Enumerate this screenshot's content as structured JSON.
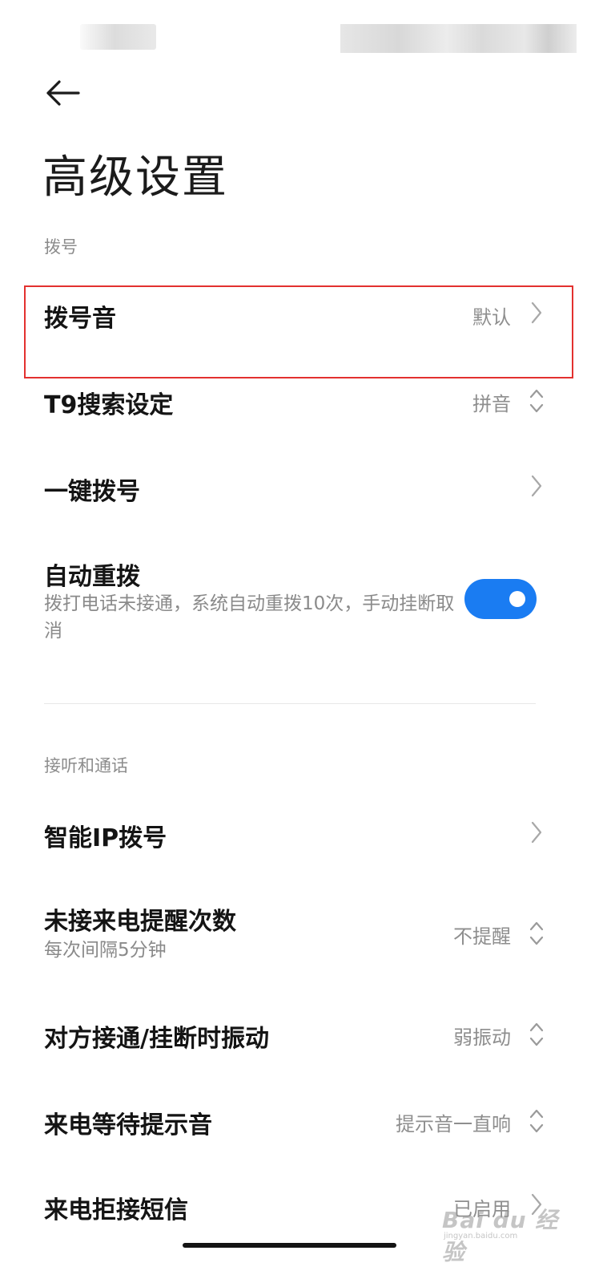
{
  "header": {
    "title": "高级设置"
  },
  "sections": {
    "dial": {
      "title": "拨号"
    },
    "call": {
      "title": "接听和通话"
    }
  },
  "items": {
    "dial_tone": {
      "title": "拨号音",
      "value": "默认"
    },
    "t9_search": {
      "title": "T9搜索设定",
      "value": "拼音"
    },
    "speed_dial": {
      "title": "一键拨号"
    },
    "auto_redial": {
      "title": "自动重拨",
      "subtitle": "拨打电话未接通，系统自动重拨10次，手动挂断取消",
      "enabled": true
    },
    "smart_ip": {
      "title": "智能IP拨号"
    },
    "missed_call_reminder": {
      "title": "未接来电提醒次数",
      "subtitle": "每次间隔5分钟",
      "value": "不提醒"
    },
    "vibrate_on_connect": {
      "title": "对方接通/挂断时振动",
      "value": "弱振动"
    },
    "call_waiting_tone": {
      "title": "来电等待提示音",
      "value": "提示音一直响"
    },
    "reject_sms": {
      "title": "来电拒接短信",
      "value": "已启用"
    }
  },
  "colors": {
    "accent": "#1a7cf2",
    "highlight_box": "#e3312f"
  },
  "watermark": {
    "main": "Bai du 经验",
    "sub": "jingyan.baidu.com"
  }
}
